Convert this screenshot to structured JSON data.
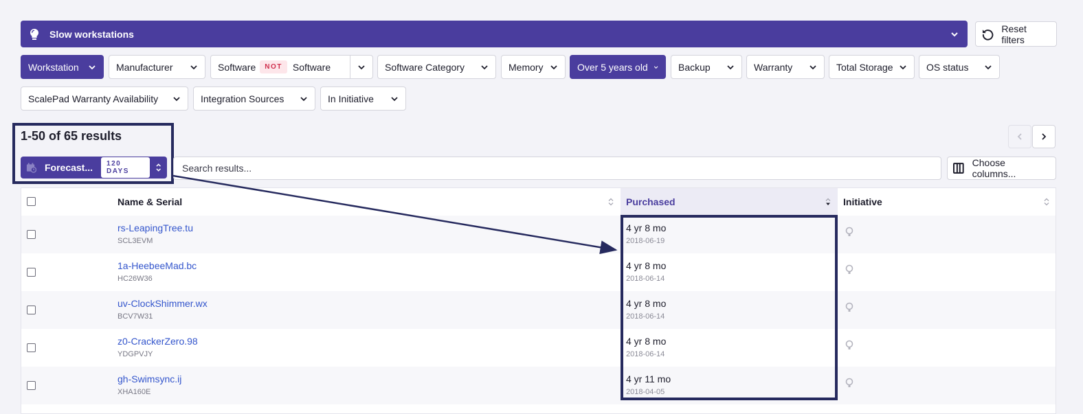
{
  "view": {
    "title": "Slow workstations"
  },
  "reset_label": "Reset filters",
  "filters": {
    "workstation": "Workstation",
    "manufacturer": "Manufacturer",
    "software": "Software",
    "not_badge": "NOT",
    "software_not": "Software",
    "software_category": "Software Category",
    "memory": "Memory",
    "over5": "Over 5 years old",
    "backup": "Backup",
    "warranty": "Warranty",
    "total_storage": "Total Storage",
    "os_status": "OS status",
    "scalepad_warranty": "ScalePad Warranty Availability",
    "integration_sources": "Integration Sources",
    "in_initiative": "In Initiative"
  },
  "results": {
    "count": "1-50 of 65 results"
  },
  "forecast": {
    "label": "Forecast...",
    "days": "120 DAYS"
  },
  "search": {
    "placeholder": "Search results..."
  },
  "choose_columns": "Choose columns...",
  "table": {
    "headers": {
      "name": "Name & Serial",
      "purchased": "Purchased",
      "initiative": "Initiative"
    },
    "rows": [
      {
        "name": "rs-LeapingTree.tu",
        "serial": "SCL3EVM",
        "age": "4 yr 8 mo",
        "date": "2018-06-19"
      },
      {
        "name": "1a-HeebeeMad.bc",
        "serial": "HC26W36",
        "age": "4 yr 8 mo",
        "date": "2018-06-14"
      },
      {
        "name": "uv-ClockShimmer.wx",
        "serial": "BCV7W31",
        "age": "4 yr 8 mo",
        "date": "2018-06-14"
      },
      {
        "name": "z0-CrackerZero.98",
        "serial": "YDGPVJY",
        "age": "4 yr 8 mo",
        "date": "2018-06-14"
      },
      {
        "name": "gh-Swimsync.ij",
        "serial": "XHA160E",
        "age": "4 yr 11 mo",
        "date": "2018-04-05"
      }
    ]
  },
  "colors": {
    "primary": "#4a3d9e",
    "annotation": "#262a5e",
    "link": "#3355cc"
  }
}
